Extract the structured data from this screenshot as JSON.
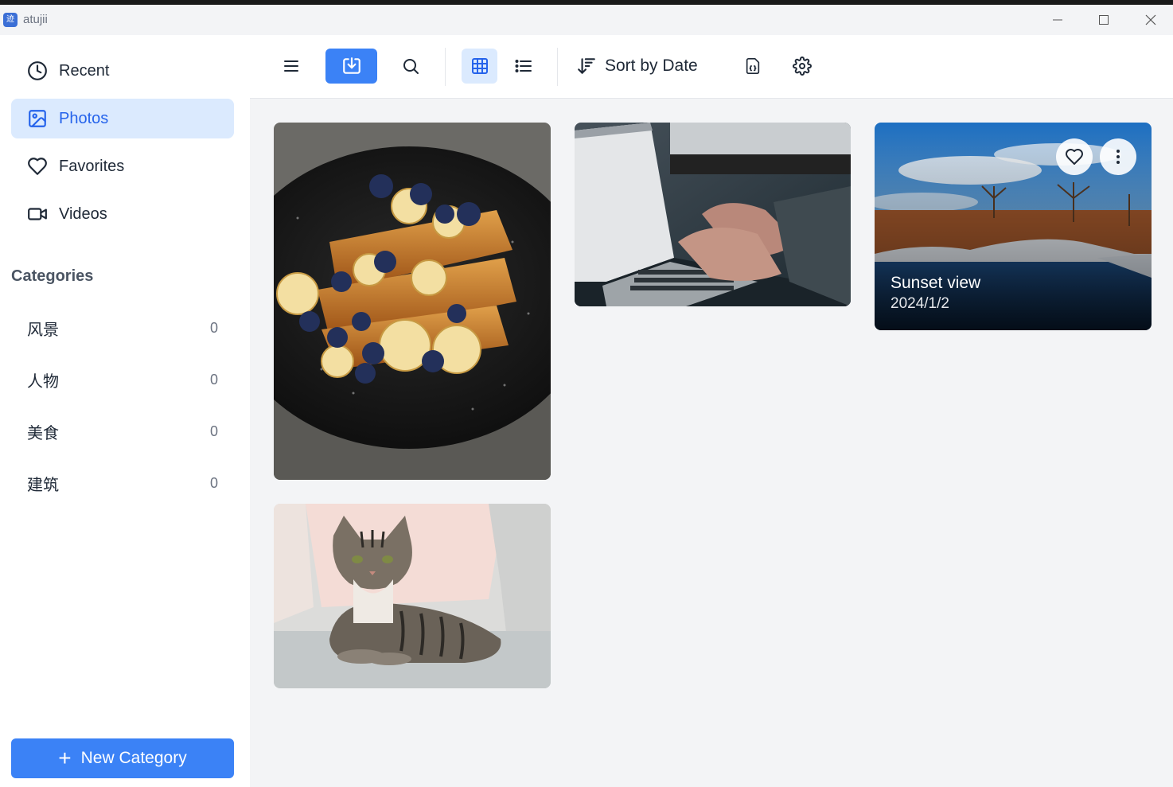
{
  "window": {
    "title": "atujii",
    "icon_glyph": "迹"
  },
  "sidebar": {
    "nav": [
      {
        "label": "Recent",
        "icon": "clock-icon"
      },
      {
        "label": "Photos",
        "icon": "image-icon",
        "active": true
      },
      {
        "label": "Favorites",
        "icon": "heart-icon"
      },
      {
        "label": "Videos",
        "icon": "video-icon"
      }
    ],
    "categories_heading": "Categories",
    "categories": [
      {
        "name": "风景",
        "count": "0"
      },
      {
        "name": "人物",
        "count": "0"
      },
      {
        "name": "美食",
        "count": "0"
      },
      {
        "name": "建筑",
        "count": "0"
      }
    ],
    "new_category_label": "New Category"
  },
  "toolbar": {
    "sort_label": "Sort by Date",
    "view_mode": "grid"
  },
  "gallery": {
    "items": [
      {
        "subject": "french toast with bananas and blueberries"
      },
      {
        "subject": "hands typing on laptop"
      },
      {
        "subject": "winter river landscape",
        "title": "Sunset view",
        "date": "2024/1/2",
        "hovered": true
      },
      {
        "subject": "tabby cat on sofa"
      }
    ]
  },
  "colors": {
    "accent": "#3b82f6",
    "active_bg": "#dbeafe",
    "active_text": "#2563eb",
    "gallery_bg": "#f3f4f6"
  }
}
